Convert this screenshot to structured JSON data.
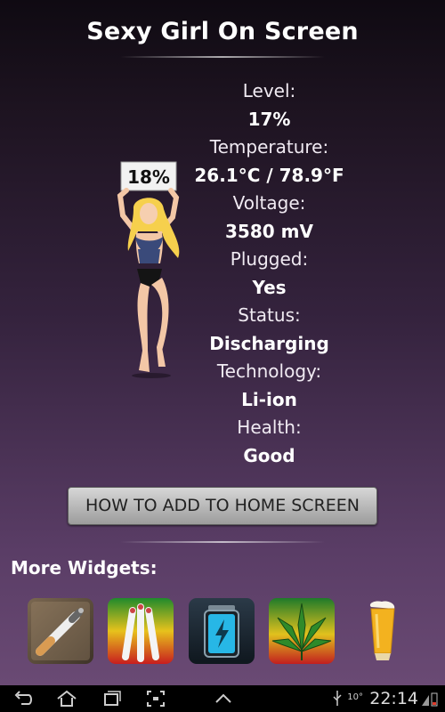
{
  "header": {
    "title": "Sexy Girl On Screen"
  },
  "figure": {
    "sign_text": "18%"
  },
  "battery": [
    {
      "label": "Level:",
      "value": "17%"
    },
    {
      "label": "Temperature:",
      "value": "26.1°C / 78.9°F"
    },
    {
      "label": "Voltage:",
      "value": "3580 mV"
    },
    {
      "label": "Plugged:",
      "value": "Yes"
    },
    {
      "label": "Status:",
      "value": "Discharging"
    },
    {
      "label": "Technology:",
      "value": "Li-ion"
    },
    {
      "label": "Health:",
      "value": "Good"
    }
  ],
  "howto_button": {
    "label": "HOW TO ADD TO HOME SCREEN"
  },
  "more_widgets": {
    "heading": "More Widgets:"
  },
  "apps": [
    {
      "icon": "cigarette-icon"
    },
    {
      "icon": "joints-icon"
    },
    {
      "icon": "battery-icon"
    },
    {
      "icon": "cannabis-leaf-icon"
    },
    {
      "icon": "beer-glass-icon"
    }
  ],
  "status_bar": {
    "time": "22:14",
    "temperature": "10°"
  },
  "colors": {
    "accent_green": "#2a8a2a",
    "battery_blue": "#27b7e6"
  }
}
